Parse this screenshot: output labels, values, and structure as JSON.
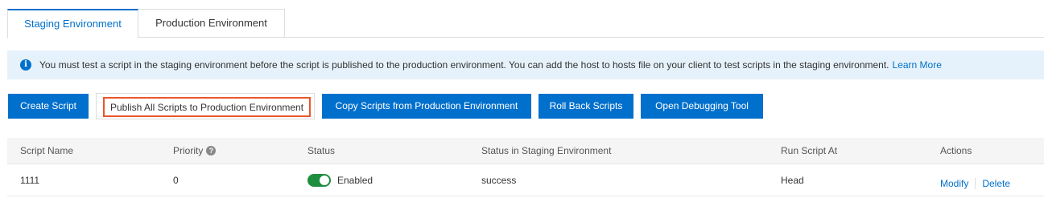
{
  "tabs": [
    {
      "label": "Staging Environment",
      "active": true
    },
    {
      "label": "Production Environment",
      "active": false
    }
  ],
  "notice": {
    "icon": "info-icon",
    "text": "You must test a script in the staging environment before the script is published to the production environment. You can add the host to hosts file on your client to test scripts in the staging environment.",
    "link": "Learn More"
  },
  "toolbar": {
    "create_label": "Create Script",
    "publish_label": "Publish All Scripts to Production Environment",
    "copy_label": "Copy Scripts from Production Environment",
    "rollback_label": "Roll Back Scripts",
    "debug_label": "Open Debugging Tool"
  },
  "table": {
    "headers": [
      "Script Name",
      "Priority",
      "Status",
      "Status in Staging Environment",
      "Run Script At",
      "Actions"
    ],
    "rows": [
      {
        "name": "1111",
        "priority": "0",
        "status": "Enabled",
        "staging_status": "success",
        "run_at": "Head",
        "actions": [
          "Modify",
          "Delete"
        ]
      }
    ]
  },
  "colors": {
    "accent": "#0070cc",
    "highlight_border": "#e8562e",
    "switch_on": "#1e8e3e"
  }
}
